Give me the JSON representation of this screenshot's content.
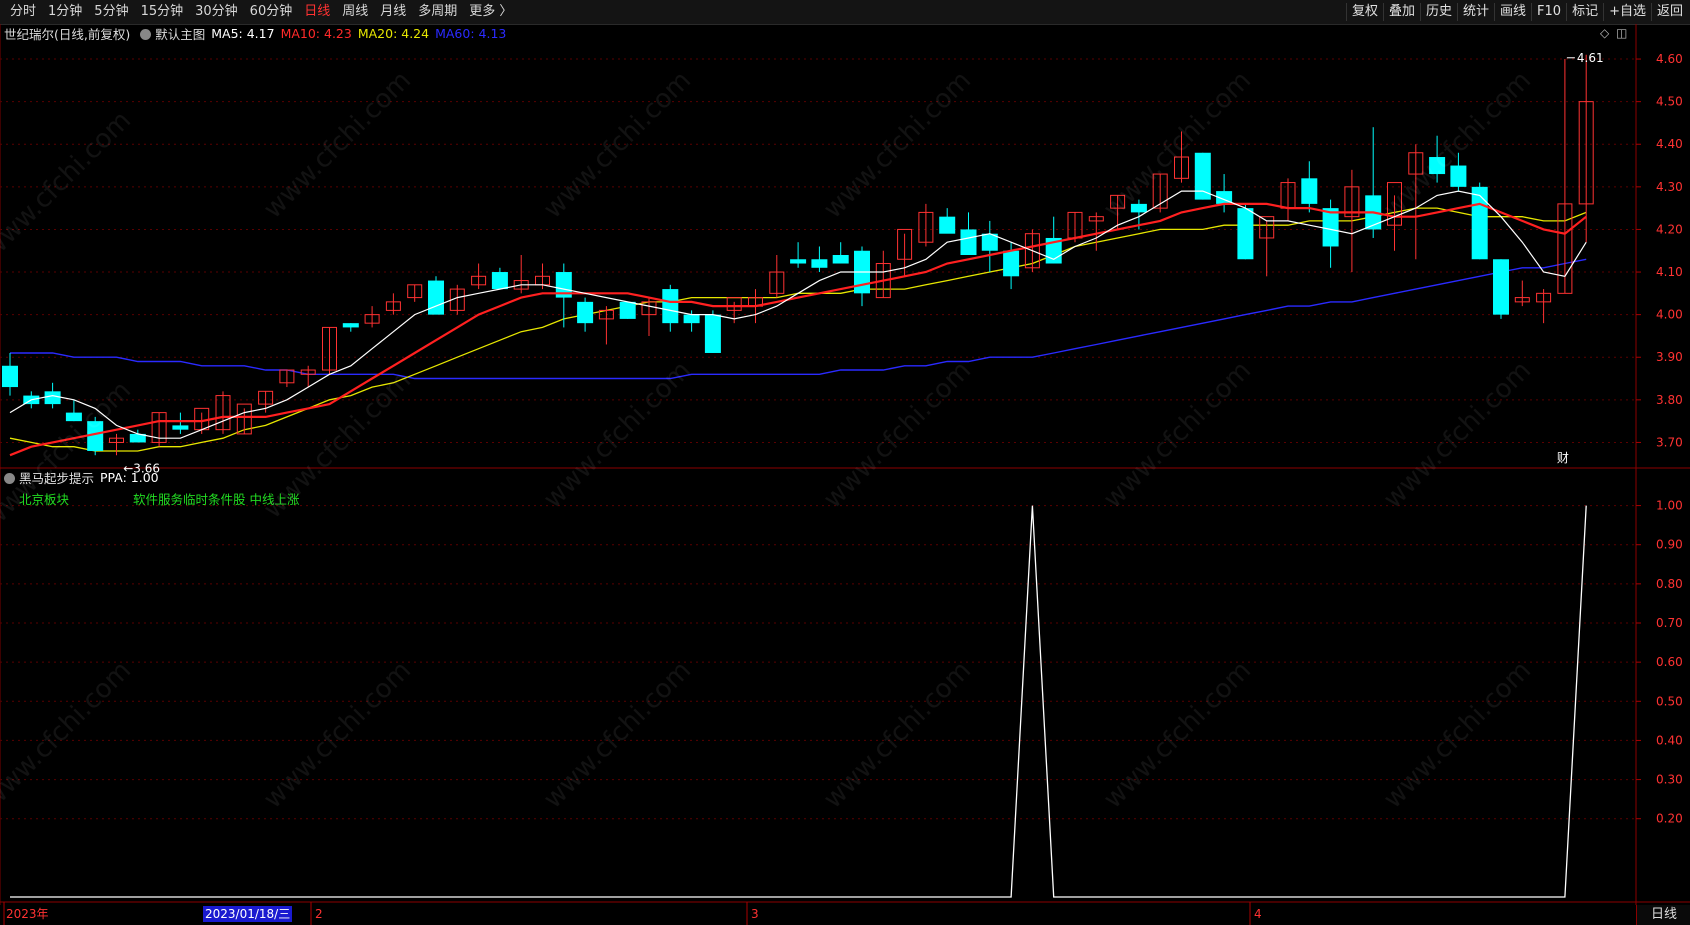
{
  "toolbar": {
    "periods": [
      "分时",
      "1分钟",
      "5分钟",
      "15分钟",
      "30分钟",
      "60分钟",
      "日线",
      "周线",
      "月线",
      "多周期",
      "更多 〉"
    ],
    "active_period": "日线",
    "tools": [
      "复权",
      "叠加",
      "历史",
      "统计",
      "画线",
      "F10",
      "标记",
      "+自选",
      "返回"
    ]
  },
  "main_panel": {
    "stock_title": "世纪瑞尔(日线,前复权)",
    "indicator_name": "默认主图",
    "ma5": {
      "label": "MA5: 4.17",
      "color": "#ffffff"
    },
    "ma10": {
      "label": "MA10: 4.23",
      "color": "#ff2a2a"
    },
    "ma20": {
      "label": "MA20: 4.24",
      "color": "#e6e600"
    },
    "ma60": {
      "label": "MA60: 4.13",
      "color": "#2020ff"
    },
    "high_label": "4.61",
    "low_label": "←3.66",
    "finance_marker": "财",
    "y_ticks": [
      "4.60",
      "4.50",
      "4.40",
      "4.30",
      "4.20",
      "4.10",
      "4.00",
      "3.90",
      "3.80",
      "3.70"
    ]
  },
  "sub_panel": {
    "indicator_title": "黑马起步提示",
    "ppa_label": "PPA: 1.00",
    "tag_sector": "北京板块",
    "tag_concepts": "软件服务临时条件股 中线上涨",
    "y_ticks": [
      "1.00",
      "0.90",
      "0.80",
      "0.70",
      "0.60",
      "0.50",
      "0.40",
      "0.30",
      "0.20"
    ]
  },
  "x_axis": {
    "labels": [
      "2023年",
      "2",
      "3",
      "4"
    ],
    "cursor_date": "2023/01/18/三"
  },
  "bottom_tab": "日线",
  "watermark": "www.cfchi.com",
  "colors": {
    "up": "#ff3232",
    "down": "#00ffff",
    "grid": "#7a0000",
    "axis_text": "#ff3232"
  },
  "chart_data": {
    "type": "candlestick",
    "ohlc": [
      [
        3.88,
        3.91,
        3.81,
        3.83
      ],
      [
        3.81,
        3.82,
        3.78,
        3.79
      ],
      [
        3.82,
        3.84,
        3.78,
        3.79
      ],
      [
        3.77,
        3.8,
        3.75,
        3.75
      ],
      [
        3.75,
        3.76,
        3.67,
        3.68
      ],
      [
        3.7,
        3.72,
        3.67,
        3.71
      ],
      [
        3.72,
        3.73,
        3.7,
        3.7
      ],
      [
        3.7,
        3.77,
        3.69,
        3.77
      ],
      [
        3.74,
        3.77,
        3.72,
        3.73
      ],
      [
        3.73,
        3.77,
        3.72,
        3.78
      ],
      [
        3.73,
        3.82,
        3.72,
        3.81
      ],
      [
        3.72,
        3.78,
        3.72,
        3.79
      ],
      [
        3.79,
        3.82,
        3.77,
        3.82
      ],
      [
        3.84,
        3.87,
        3.83,
        3.87
      ],
      [
        3.86,
        3.88,
        3.83,
        3.87
      ],
      [
        3.87,
        3.97,
        3.86,
        3.97
      ],
      [
        3.98,
        3.98,
        3.96,
        3.97
      ],
      [
        3.98,
        4.02,
        3.97,
        4.0
      ],
      [
        4.01,
        4.05,
        4.0,
        4.03
      ],
      [
        4.04,
        4.07,
        4.03,
        4.07
      ],
      [
        4.08,
        4.09,
        4.01,
        4.0
      ],
      [
        4.01,
        4.07,
        4.0,
        4.06
      ],
      [
        4.07,
        4.12,
        4.06,
        4.09
      ],
      [
        4.1,
        4.11,
        4.06,
        4.06
      ],
      [
        4.06,
        4.14,
        4.05,
        4.08
      ],
      [
        4.07,
        4.12,
        4.06,
        4.09
      ],
      [
        4.1,
        4.12,
        3.97,
        4.04
      ],
      [
        4.03,
        4.04,
        3.96,
        3.98
      ],
      [
        3.99,
        4.02,
        3.93,
        4.01
      ],
      [
        4.03,
        4.03,
        3.99,
        3.99
      ],
      [
        4.0,
        4.04,
        3.95,
        4.03
      ],
      [
        4.06,
        4.07,
        3.96,
        3.98
      ],
      [
        4.0,
        4.01,
        3.96,
        3.98
      ],
      [
        4.0,
        4.01,
        3.91,
        3.91
      ],
      [
        4.01,
        4.03,
        3.98,
        4.04
      ],
      [
        4.02,
        4.06,
        3.98,
        4.04
      ],
      [
        4.05,
        4.14,
        4.04,
        4.1
      ],
      [
        4.13,
        4.17,
        4.11,
        4.12
      ],
      [
        4.13,
        4.16,
        4.1,
        4.11
      ],
      [
        4.14,
        4.17,
        4.12,
        4.12
      ],
      [
        4.15,
        4.16,
        4.02,
        4.05
      ],
      [
        4.04,
        4.15,
        4.04,
        4.12
      ],
      [
        4.13,
        4.19,
        4.09,
        4.2
      ],
      [
        4.17,
        4.26,
        4.16,
        4.24
      ],
      [
        4.23,
        4.25,
        4.2,
        4.19
      ],
      [
        4.2,
        4.24,
        4.17,
        4.14
      ],
      [
        4.19,
        4.22,
        4.1,
        4.15
      ],
      [
        4.15,
        4.17,
        4.06,
        4.09
      ],
      [
        4.11,
        4.2,
        4.1,
        4.19
      ],
      [
        4.18,
        4.23,
        4.12,
        4.12
      ],
      [
        4.18,
        4.24,
        4.17,
        4.24
      ],
      [
        4.22,
        4.24,
        4.15,
        4.23
      ],
      [
        4.25,
        4.28,
        4.2,
        4.28
      ],
      [
        4.26,
        4.27,
        4.2,
        4.24
      ],
      [
        4.25,
        4.33,
        4.24,
        4.33
      ],
      [
        4.32,
        4.43,
        4.31,
        4.37
      ],
      [
        4.38,
        4.38,
        4.27,
        4.27
      ],
      [
        4.29,
        4.33,
        4.24,
        4.26
      ],
      [
        4.25,
        4.26,
        4.13,
        4.13
      ],
      [
        4.18,
        4.22,
        4.09,
        4.23
      ],
      [
        4.25,
        4.32,
        4.22,
        4.31
      ],
      [
        4.32,
        4.36,
        4.24,
        4.26
      ],
      [
        4.25,
        4.27,
        4.11,
        4.16
      ],
      [
        4.23,
        4.34,
        4.1,
        4.3
      ],
      [
        4.28,
        4.44,
        4.18,
        4.2
      ],
      [
        4.21,
        4.28,
        4.15,
        4.31
      ],
      [
        4.33,
        4.4,
        4.13,
        4.38
      ],
      [
        4.37,
        4.42,
        4.31,
        4.33
      ],
      [
        4.35,
        4.38,
        4.29,
        4.3
      ],
      [
        4.3,
        4.31,
        4.13,
        4.13
      ],
      [
        4.13,
        4.13,
        3.99,
        4.0
      ],
      [
        4.03,
        4.08,
        4.02,
        4.04
      ],
      [
        4.03,
        4.06,
        3.98,
        4.05
      ],
      [
        4.05,
        4.6,
        4.05,
        4.26
      ],
      [
        4.26,
        4.61,
        4.17,
        4.5
      ]
    ],
    "ma5": [
      3.77,
      3.8,
      3.81,
      3.8,
      3.78,
      3.74,
      3.72,
      3.71,
      3.71,
      3.73,
      3.75,
      3.77,
      3.78,
      3.8,
      3.83,
      3.86,
      3.88,
      3.92,
      3.96,
      4.0,
      4.02,
      4.04,
      4.05,
      4.06,
      4.07,
      4.07,
      4.06,
      4.05,
      4.04,
      4.03,
      4.02,
      4.01,
      4.0,
      4.0,
      3.99,
      4.0,
      4.02,
      4.05,
      4.08,
      4.1,
      4.1,
      4.1,
      4.11,
      4.13,
      4.17,
      4.18,
      4.19,
      4.17,
      4.15,
      4.13,
      4.16,
      4.18,
      4.21,
      4.23,
      4.26,
      4.29,
      4.29,
      4.27,
      4.25,
      4.22,
      4.22,
      4.21,
      4.2,
      4.19,
      4.21,
      4.23,
      4.25,
      4.28,
      4.29,
      4.28,
      4.23,
      4.17,
      4.1,
      4.09,
      4.17
    ],
    "ma10": [
      3.67,
      3.69,
      3.7,
      3.71,
      3.72,
      3.73,
      3.74,
      3.75,
      3.75,
      3.75,
      3.76,
      3.76,
      3.76,
      3.77,
      3.78,
      3.79,
      3.82,
      3.85,
      3.88,
      3.91,
      3.94,
      3.97,
      4.0,
      4.02,
      4.04,
      4.05,
      4.05,
      4.05,
      4.05,
      4.05,
      4.04,
      4.03,
      4.03,
      4.02,
      4.02,
      4.02,
      4.03,
      4.04,
      4.05,
      4.06,
      4.07,
      4.08,
      4.09,
      4.1,
      4.12,
      4.13,
      4.14,
      4.15,
      4.16,
      4.17,
      4.18,
      4.19,
      4.2,
      4.21,
      4.22,
      4.24,
      4.25,
      4.26,
      4.26,
      4.26,
      4.25,
      4.25,
      4.24,
      4.24,
      4.24,
      4.23,
      4.23,
      4.24,
      4.25,
      4.26,
      4.24,
      4.22,
      4.2,
      4.19,
      4.23
    ],
    "ma20": [
      3.71,
      3.7,
      3.69,
      3.69,
      3.68,
      3.68,
      3.68,
      3.69,
      3.69,
      3.7,
      3.71,
      3.73,
      3.74,
      3.76,
      3.78,
      3.8,
      3.81,
      3.83,
      3.84,
      3.86,
      3.88,
      3.9,
      3.92,
      3.94,
      3.96,
      3.97,
      3.99,
      4.0,
      4.01,
      4.02,
      4.03,
      4.03,
      4.04,
      4.04,
      4.04,
      4.04,
      4.04,
      4.05,
      4.05,
      4.05,
      4.06,
      4.06,
      4.06,
      4.07,
      4.08,
      4.09,
      4.1,
      4.11,
      4.12,
      4.14,
      4.16,
      4.17,
      4.18,
      4.19,
      4.2,
      4.2,
      4.2,
      4.21,
      4.21,
      4.21,
      4.21,
      4.22,
      4.22,
      4.22,
      4.23,
      4.24,
      4.25,
      4.25,
      4.24,
      4.23,
      4.23,
      4.23,
      4.22,
      4.22,
      4.24
    ],
    "ma60": [
      3.91,
      3.91,
      3.91,
      3.9,
      3.9,
      3.9,
      3.89,
      3.89,
      3.89,
      3.88,
      3.88,
      3.88,
      3.87,
      3.87,
      3.86,
      3.86,
      3.86,
      3.86,
      3.86,
      3.85,
      3.85,
      3.85,
      3.85,
      3.85,
      3.85,
      3.85,
      3.85,
      3.85,
      3.85,
      3.85,
      3.85,
      3.85,
      3.86,
      3.86,
      3.86,
      3.86,
      3.86,
      3.86,
      3.86,
      3.87,
      3.87,
      3.87,
      3.88,
      3.88,
      3.89,
      3.89,
      3.9,
      3.9,
      3.9,
      3.91,
      3.92,
      3.93,
      3.94,
      3.95,
      3.96,
      3.97,
      3.98,
      3.99,
      4.0,
      4.01,
      4.02,
      4.02,
      4.03,
      4.03,
      4.04,
      4.05,
      4.06,
      4.07,
      4.08,
      4.09,
      4.1,
      4.11,
      4.11,
      4.12,
      4.13
    ],
    "ppa": [
      0,
      0,
      0,
      0,
      0,
      0,
      0,
      0,
      0,
      0,
      0,
      0,
      0,
      0,
      0,
      0,
      0,
      0,
      0,
      0,
      0,
      0,
      0,
      0,
      0,
      0,
      0,
      0,
      0,
      0,
      0,
      0,
      0,
      0,
      0,
      0,
      0,
      0,
      0,
      0,
      0,
      0,
      0,
      0,
      0,
      0,
      0,
      0,
      1,
      0,
      0,
      0,
      0,
      0,
      0,
      0,
      0,
      0,
      0,
      0,
      0,
      0,
      0,
      0,
      0,
      0,
      0,
      0,
      0,
      0,
      0,
      0,
      0,
      0,
      1
    ],
    "main_ylim": [
      3.64,
      4.64
    ],
    "sub_ylim": [
      0,
      1.05
    ],
    "x_labels": [
      "2023年",
      "2",
      "3",
      "4"
    ]
  }
}
